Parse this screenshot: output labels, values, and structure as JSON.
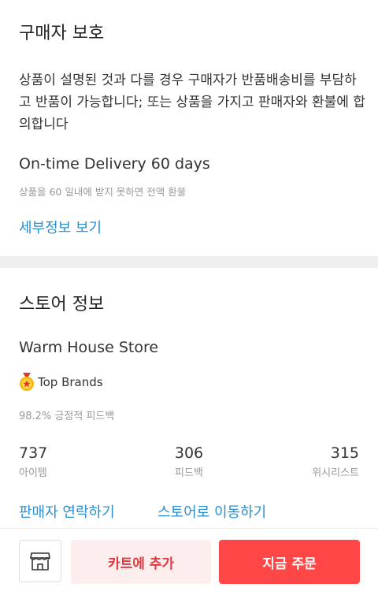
{
  "buyer_protection": {
    "title": "구매자 보호",
    "description": "상품이 설명된 것과 다를 경우 구매자가 반품배송비를 부담하고 반품이 가능합니다; 또는 상품을 가지고 판매자와 환불에 합의합니다",
    "delivery_title": "On-time Delivery 60 days",
    "delivery_note": "상품을 60 일내에 받지 못하면 전액 환불",
    "details_link": "세부정보 보기"
  },
  "store_info": {
    "title": "스토어 정보",
    "store_name": "Warm House Store",
    "badge_label": "Top Brands",
    "feedback_percent": "98.2% 긍정적 피드백",
    "stats": [
      {
        "value": "737",
        "label": "아이템"
      },
      {
        "value": "306",
        "label": "피드백"
      },
      {
        "value": "315",
        "label": "위시리스트"
      }
    ],
    "contact_link": "판매자 연락하기",
    "store_link": "스토어로 이동하기"
  },
  "bottom_bar": {
    "store_icon": "storefront-icon",
    "cart_label": "카트에 추가",
    "buy_label": "지금 주문"
  },
  "colors": {
    "link": "#2a8fd0",
    "buy_button": "#ff4747",
    "cart_button_bg": "#fdeeee",
    "cart_button_text": "#e0383f"
  }
}
